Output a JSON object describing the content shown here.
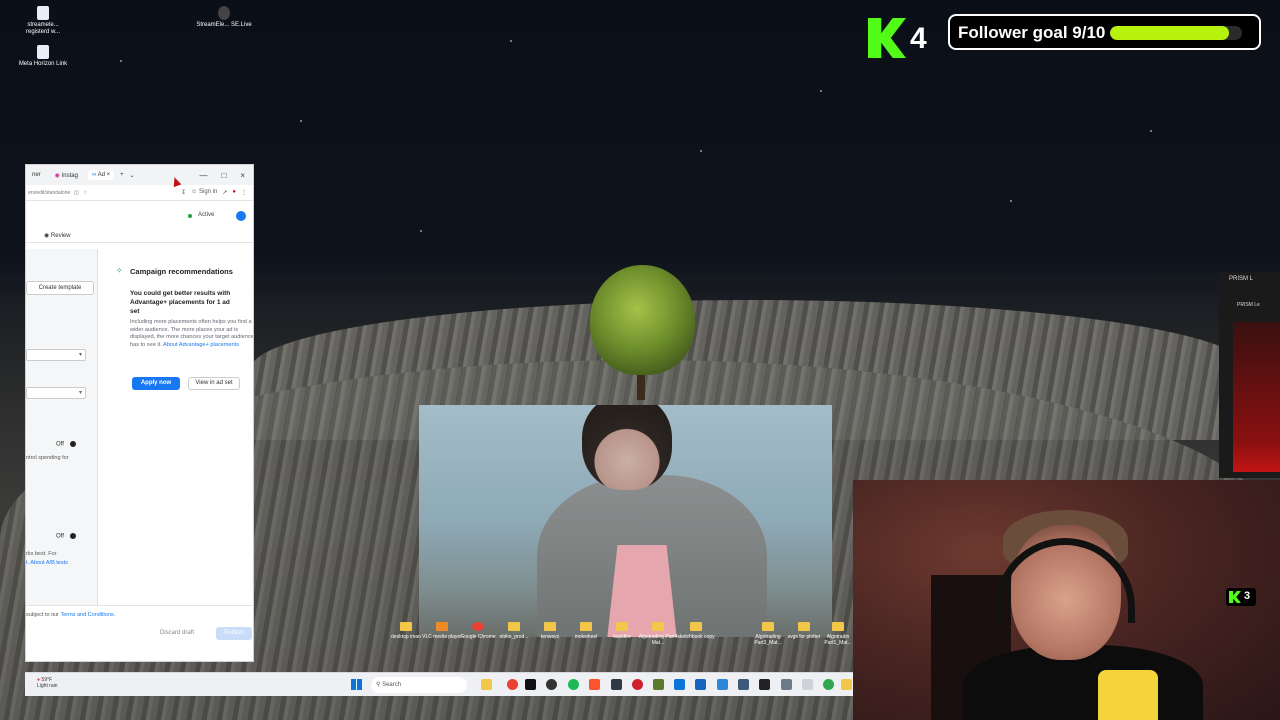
{
  "desktop": {
    "top_icons": [
      {
        "label": "streamele... registerd w..."
      },
      {
        "label": "Meta Horizon Link"
      },
      {
        "label": "StreamEle... SE.Live"
      }
    ],
    "bottom_icons": [
      {
        "label": "desktop imao"
      },
      {
        "label": "VLC media player"
      },
      {
        "label": "Google Chrome"
      },
      {
        "label": "ebike_prod..."
      },
      {
        "label": "tenways"
      },
      {
        "label": "mokwheel"
      },
      {
        "label": "backfire"
      },
      {
        "label": "Algotrading Part4 Mat..."
      },
      {
        "label": "sketchbook copy"
      },
      {
        "label": "Algotrading Part3_Mat..."
      },
      {
        "label": "svgs for plotter"
      },
      {
        "label": "Algotradin Part1_Mat..."
      }
    ]
  },
  "kick_overlay": {
    "viewer_count": "4",
    "follower_goal_label": "Follower goal 9/10",
    "follower_goal_progress": 0.9,
    "accent_color": "#53fc18",
    "bar_color": "#b6f20d",
    "camera_badge_count": "3"
  },
  "browser": {
    "tabs": [
      "ner",
      "Instag",
      "Ad"
    ],
    "address": "ers/edit/standalone",
    "sign_in": "Sign in",
    "status_label": "Active",
    "review_tab": "Review",
    "create_template": "Create template",
    "budget_toggle_label": "Off",
    "budget_text": "ntrol spending for",
    "ab_toggle_label": "Off",
    "ab_text": "rks best. For",
    "ab_link": "t. About A/B tests",
    "recommendations": {
      "title": "Campaign recommendations",
      "subtitle": "You could get better results with Advantage+ placements for 1 ad set",
      "body": "Including more placements often helps you find a wider audience. The more places your ad is displayed, the more chances your target audience has to see it.",
      "link": "About Advantage+ placements",
      "apply_button": "Apply now",
      "view_button": "View in ad set"
    },
    "footer_terms_prefix": "subject to our ",
    "footer_terms_link": "Terms and Conditions.",
    "discard_button": "Discard draft",
    "publish_button": "Publish",
    "accent_color": "#1877f2"
  },
  "prism": {
    "title": "PRISM L",
    "subtitle": "PRISM Le"
  },
  "taskbar": {
    "weather_temp": "59°F",
    "weather_desc": "Light rain",
    "search_placeholder": "Search"
  }
}
